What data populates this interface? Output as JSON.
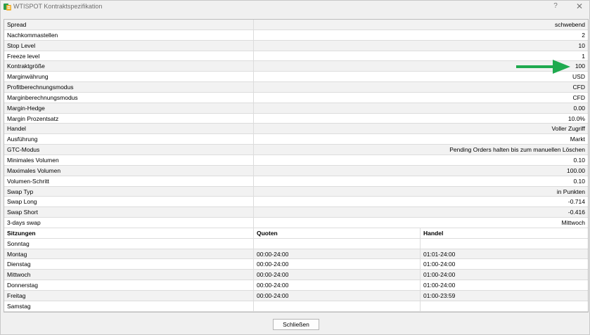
{
  "window": {
    "title": "WTISPOT Kontraktspezifikation",
    "help_glyph": "?",
    "close_glyph": "✕"
  },
  "specs": [
    {
      "key": "Spread",
      "value": "schwebend"
    },
    {
      "key": "Nachkommastellen",
      "value": "2"
    },
    {
      "key": "Stop Level",
      "value": "10"
    },
    {
      "key": "Freeze level",
      "value": "1"
    },
    {
      "key": "Kontraktgröße",
      "value": "100"
    },
    {
      "key": "Marginwährung",
      "value": "USD"
    },
    {
      "key": "Profitberechnungsmodus",
      "value": "CFD"
    },
    {
      "key": "Marginberechnungsmodus",
      "value": "CFD"
    },
    {
      "key": "Margin-Hedge",
      "value": "0.00"
    },
    {
      "key": "Margin Prozentsatz",
      "value": "10.0%"
    },
    {
      "key": "Handel",
      "value": "Voller Zugriff"
    },
    {
      "key": "Ausführung",
      "value": "Markt"
    },
    {
      "key": "GTC-Modus",
      "value": "Pending Orders halten bis zum manuellen Löschen"
    },
    {
      "key": "Minimales Volumen",
      "value": "0.10"
    },
    {
      "key": "Maximales Volumen",
      "value": "100.00"
    },
    {
      "key": "Volumen-Schritt",
      "value": "0.10"
    },
    {
      "key": "Swap Typ",
      "value": "in Punkten"
    },
    {
      "key": "Swap Long",
      "value": "-0.714"
    },
    {
      "key": "Swap Short",
      "value": "-0.416"
    },
    {
      "key": "3-days swap",
      "value": "Mittwoch"
    }
  ],
  "sessions": {
    "headers": [
      "Sitzungen",
      "Quoten",
      "Handel"
    ],
    "rows": [
      {
        "day": "Sonntag",
        "quotes": "",
        "trade": ""
      },
      {
        "day": "Montag",
        "quotes": "00:00-24:00",
        "trade": "01:01-24:00"
      },
      {
        "day": "Dienstag",
        "quotes": "00:00-24:00",
        "trade": "01:00-24:00"
      },
      {
        "day": "Mittwoch",
        "quotes": "00:00-24:00",
        "trade": "01:00-24:00"
      },
      {
        "day": "Donnerstag",
        "quotes": "00:00-24:00",
        "trade": "01:00-24:00"
      },
      {
        "day": "Freitag",
        "quotes": "00:00-24:00",
        "trade": "01:00-23:59"
      },
      {
        "day": "Samstag",
        "quotes": "",
        "trade": ""
      }
    ]
  },
  "footer": {
    "close_label": "Schließen"
  },
  "colors": {
    "arrow": "#1faa4f",
    "shade": "#f2f2f2"
  }
}
